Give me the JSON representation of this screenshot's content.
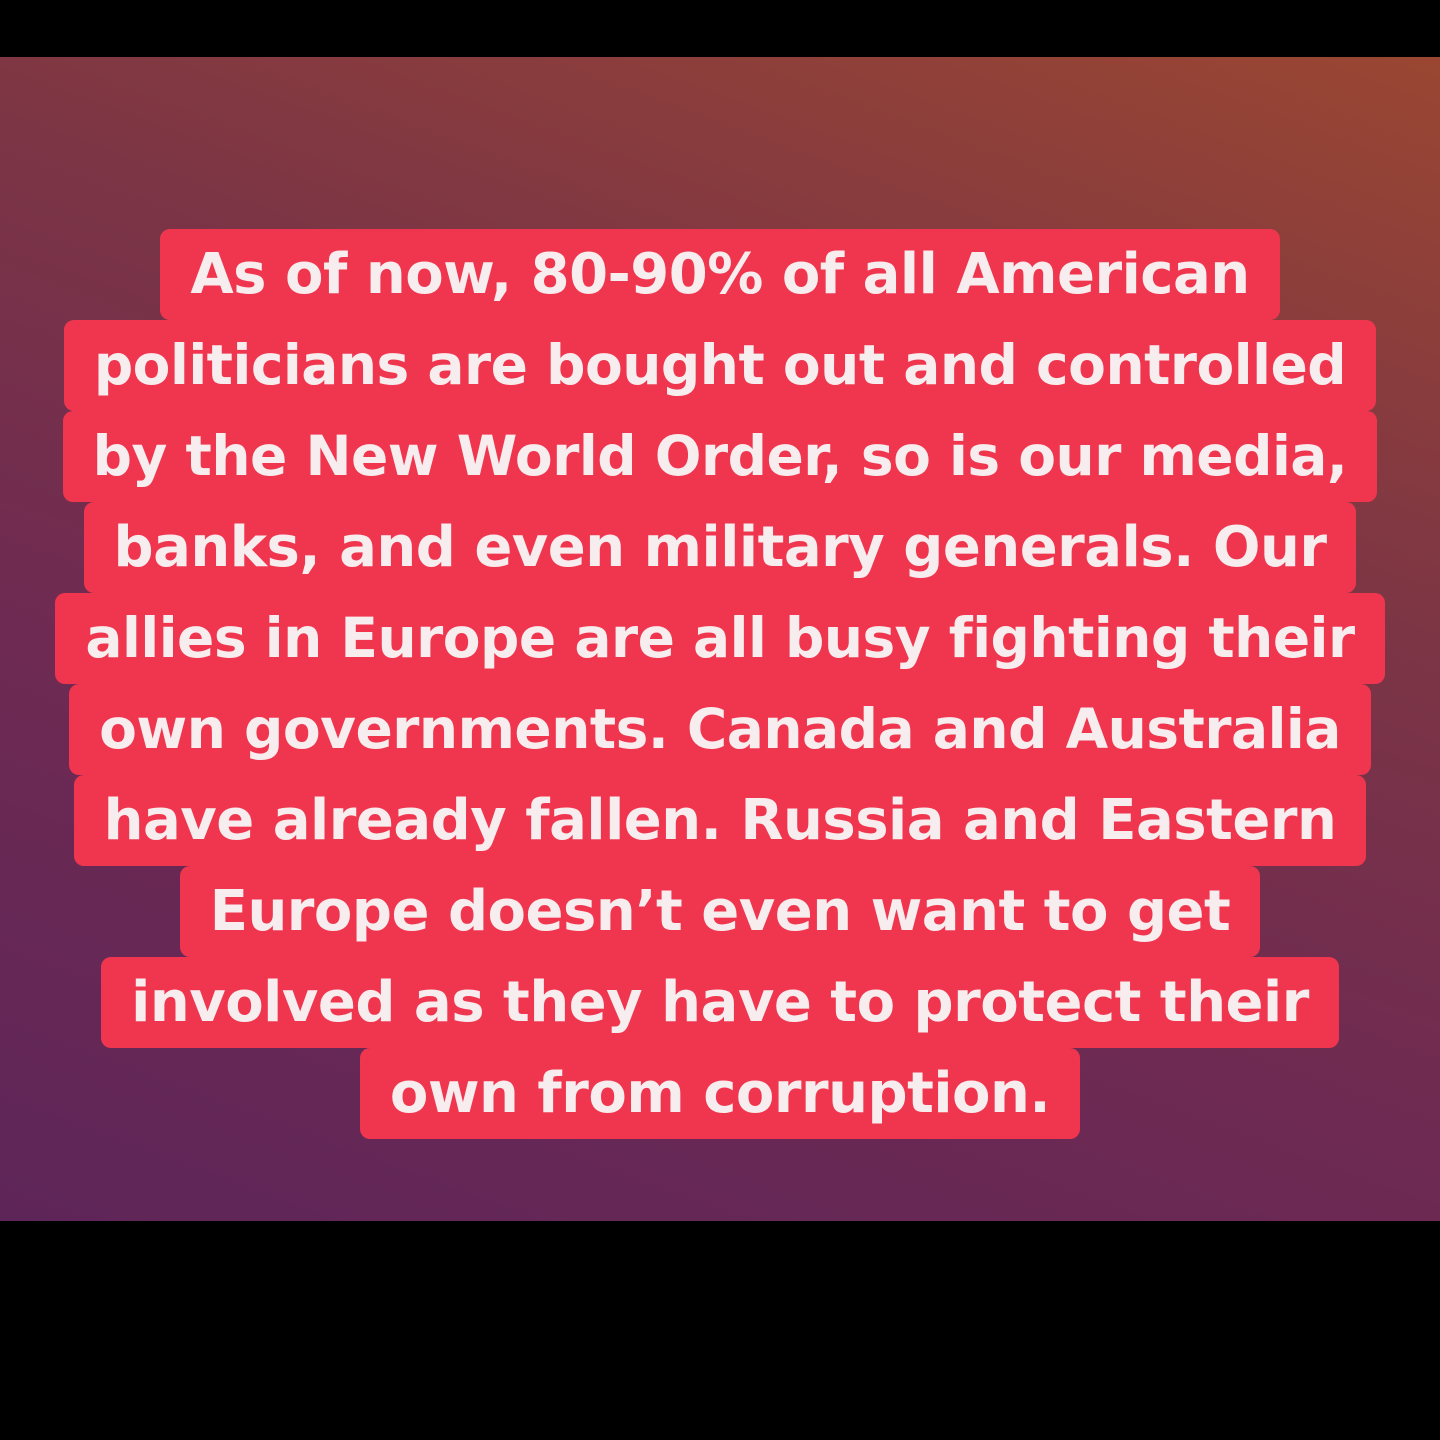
{
  "story": {
    "background_colors": [
      "#9a4632",
      "#7c3545",
      "#6e2a52",
      "#5e2559"
    ],
    "highlight_color": "#f0364f",
    "text_color": "#f7ecee",
    "lines": [
      "As of now, 80-90% of all American",
      "politicians are bought out and controlled",
      "by the New World Order, so is our media,",
      "banks, and even military generals. Our",
      "allies in Europe are all busy fighting their",
      "own governments. Canada and Australia",
      "have already fallen. Russia and Eastern",
      "Europe doesn’t even want to get",
      "involved as they have to protect their",
      "own from corruption."
    ]
  }
}
